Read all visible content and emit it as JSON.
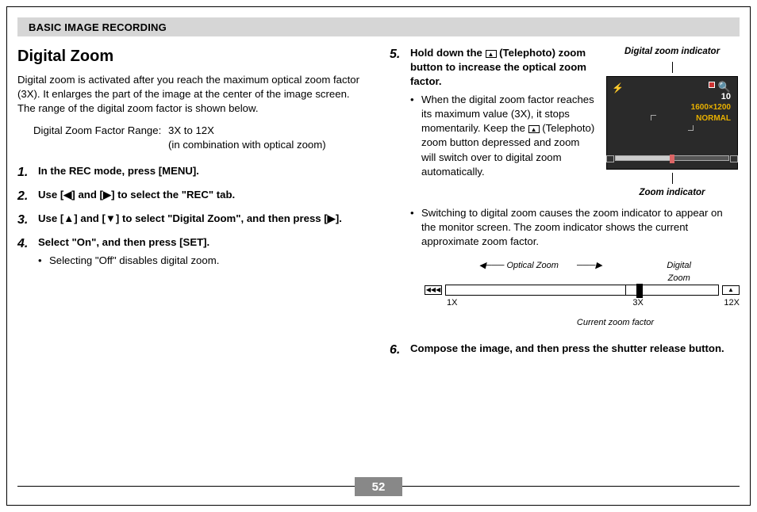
{
  "header": "BASIC IMAGE RECORDING",
  "title": "Digital Zoom",
  "intro": "Digital zoom is activated after you reach the maximum optical zoom factor (3X). It enlarges the part of the image at the center of the image screen. The range of the digital zoom factor is shown below.",
  "range": {
    "label": "Digital Zoom Factor Range:",
    "value1": "3X to 12X",
    "value2": "(in combination with optical zoom)"
  },
  "steps": {
    "s1": "In the REC mode, press [MENU].",
    "s2": "Use [◀] and [▶] to select the \"REC\" tab.",
    "s3": "Use [▲] and [▼] to select \"Digital Zoom\", and then press [▶].",
    "s4": "Select \"On\", and then press [SET].",
    "s4_sub": "Selecting \"Off\" disables digital zoom.",
    "s5_a": "Hold down the ",
    "s5_b": " (Telephoto) zoom button to increase the optical zoom factor.",
    "s5_sub_a": "When the digital zoom factor reaches its maximum value (3X), it stops momentarily. Keep the ",
    "s5_sub_b": " (Telephoto) zoom button depressed and zoom will switch over to digital zoom automatically.",
    "s5_bullet2": "Switching to digital zoom causes the zoom indicator to appear on the monitor screen. The zoom indicator shows the current approximate zoom factor.",
    "s6": "Compose the image, and then press the shutter release button."
  },
  "screen_labels": {
    "top": "Digital zoom indicator",
    "bottom": "Zoom indicator",
    "count": "10",
    "res1": "1600×1200",
    "res2": "NORMAL"
  },
  "zoom_diagram": {
    "optical": "Optical Zoom",
    "digital": "Digital\nZoom",
    "x1": "1X",
    "x3": "3X",
    "x12": "12X",
    "current": "Current zoom factor",
    "wide_icon": "◀◀◀",
    "tele_icon": "[▲]"
  },
  "page_number": "52"
}
